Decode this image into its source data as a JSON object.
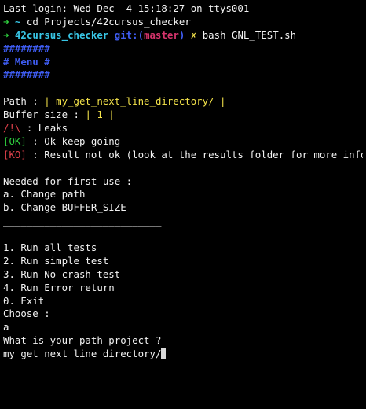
{
  "terminal": {
    "last_login": "Last login: Wed Dec  4 15:18:27 on ttys001",
    "prompt1": {
      "arrow": "➜",
      "cwd": "~",
      "command": "cd Projects/42cursus_checker"
    },
    "prompt2": {
      "arrow": "➜",
      "cwd": "42cursus_checker",
      "git_prefix": "git:(",
      "git_branch": "master",
      "git_suffix": ")",
      "dirty": "✗",
      "command": "bash GNL_TEST.sh"
    },
    "menu_border_top": "########",
    "menu_title": "# Menu #",
    "menu_border_bottom": "########",
    "path_label": "Path : ",
    "path_value": "| my_get_next_line_directory/ |",
    "buffer_label": "Buffer_size : ",
    "buffer_value": "| 1 |",
    "legend_leaks_tag": "/!\\",
    "legend_leaks_text": " : Leaks",
    "legend_ok_tag": "[OK]",
    "legend_ok_text": " : Ok keep going",
    "legend_ko_tag": "[KO]",
    "legend_ko_text": " : Result not ok (look at the results folder for more info)",
    "needed_header": "Needed for first use :",
    "option_a": "a. Change path",
    "option_b": "b. Change BUFFER_SIZE",
    "separator": "___________________________",
    "option_1": "1. Run all tests",
    "option_2": "2. Run simple test",
    "option_3": "3. Run No crash test",
    "option_4": "4. Run Error return",
    "option_0": "0. Exit",
    "choose_prompt": "Choose :",
    "choose_input": "a",
    "path_question": "What is your path project ?",
    "path_input": "my_get_next_line_directory/"
  },
  "colors": {
    "background": "#000000",
    "text": "#f2f2f2",
    "prompt_arrow": "#2fd13f",
    "cwd": "#38c6e6",
    "git_label": "#3e5cf0",
    "git_branch": "#d6346c",
    "dirty_mark": "#f3e24a",
    "menu": "#3e5cf0",
    "path_value": "#f3e24a",
    "leaks": "#e2424c",
    "ok": "#2fd13f",
    "ko": "#e2424c"
  }
}
